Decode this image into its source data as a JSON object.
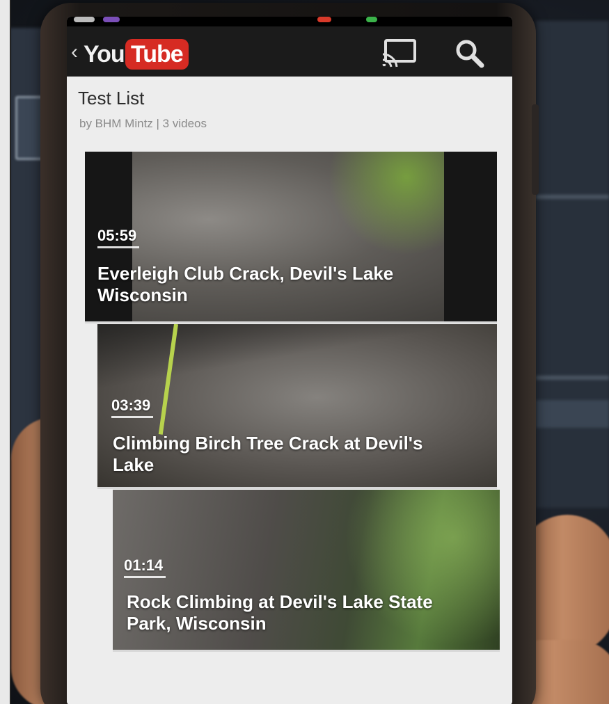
{
  "app": {
    "logo_you": "You",
    "logo_tube": "Tube",
    "back_chevron": "‹"
  },
  "playlist": {
    "title": "Test List",
    "subtitle": "by BHM Mintz | 3 videos"
  },
  "videos": [
    {
      "duration": "05:59",
      "title": "Everleigh Club Crack, Devil's Lake Wisconsin"
    },
    {
      "duration": "03:39",
      "title": "Climbing Birch Tree Crack at Devil's Lake"
    },
    {
      "duration": "01:14",
      "title": "Rock Climbing at Devil's Lake State Park, Wisconsin"
    }
  ],
  "icons": {
    "cast": "cast-icon",
    "search": "search-icon"
  },
  "colors": {
    "youtube_red": "#d62b23",
    "action_bar": "#1b1b1b",
    "content_bg": "#ededed"
  }
}
